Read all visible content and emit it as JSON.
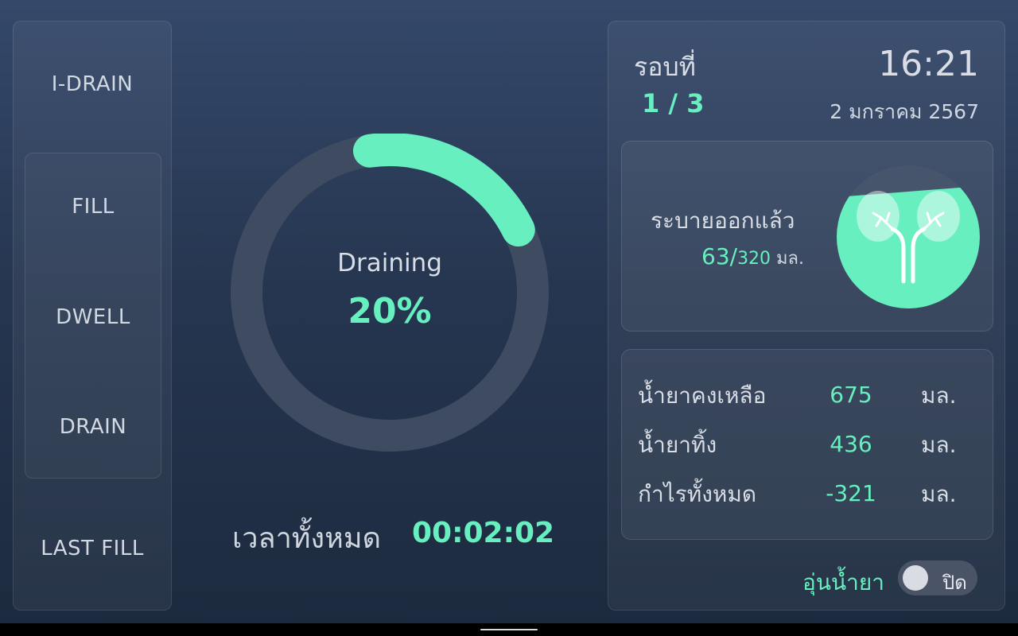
{
  "phases": {
    "items": [
      {
        "label": "I-DRAIN"
      },
      {
        "label": "FILL"
      },
      {
        "label": "DWELL"
      },
      {
        "label": "DRAIN"
      },
      {
        "label": "LAST FILL"
      }
    ]
  },
  "progress": {
    "status_label": "Draining",
    "percent_text": "20%",
    "fraction": 0.2,
    "total_time_label": "เวลาทั้งหมด",
    "total_time_value": "00:02:02"
  },
  "header": {
    "round_label": "รอบที่",
    "round_value": "1 / 3",
    "time": "16:21",
    "date": "2 มกราคม 2567"
  },
  "drained": {
    "label": "ระบายออกแล้ว",
    "current": "63/",
    "total": "320",
    "unit": " มล.",
    "fraction": 0.2
  },
  "stats": [
    {
      "label": "น้ำยาคงเหลือ",
      "value": "675",
      "unit": "มล."
    },
    {
      "label": "น้ำยาทิ้ง",
      "value": "436",
      "unit": "มล."
    },
    {
      "label": "กำไรทั้งหมด",
      "value": "-321",
      "unit": "มล."
    }
  ],
  "warmer": {
    "label": "อุ่นน้ำยา",
    "state_text": "ปิด"
  },
  "colors": {
    "accent": "#67efc0",
    "track": "#3f4b60",
    "text": "#d8dde6"
  },
  "icons": {
    "kidney": "kidney-icon"
  }
}
